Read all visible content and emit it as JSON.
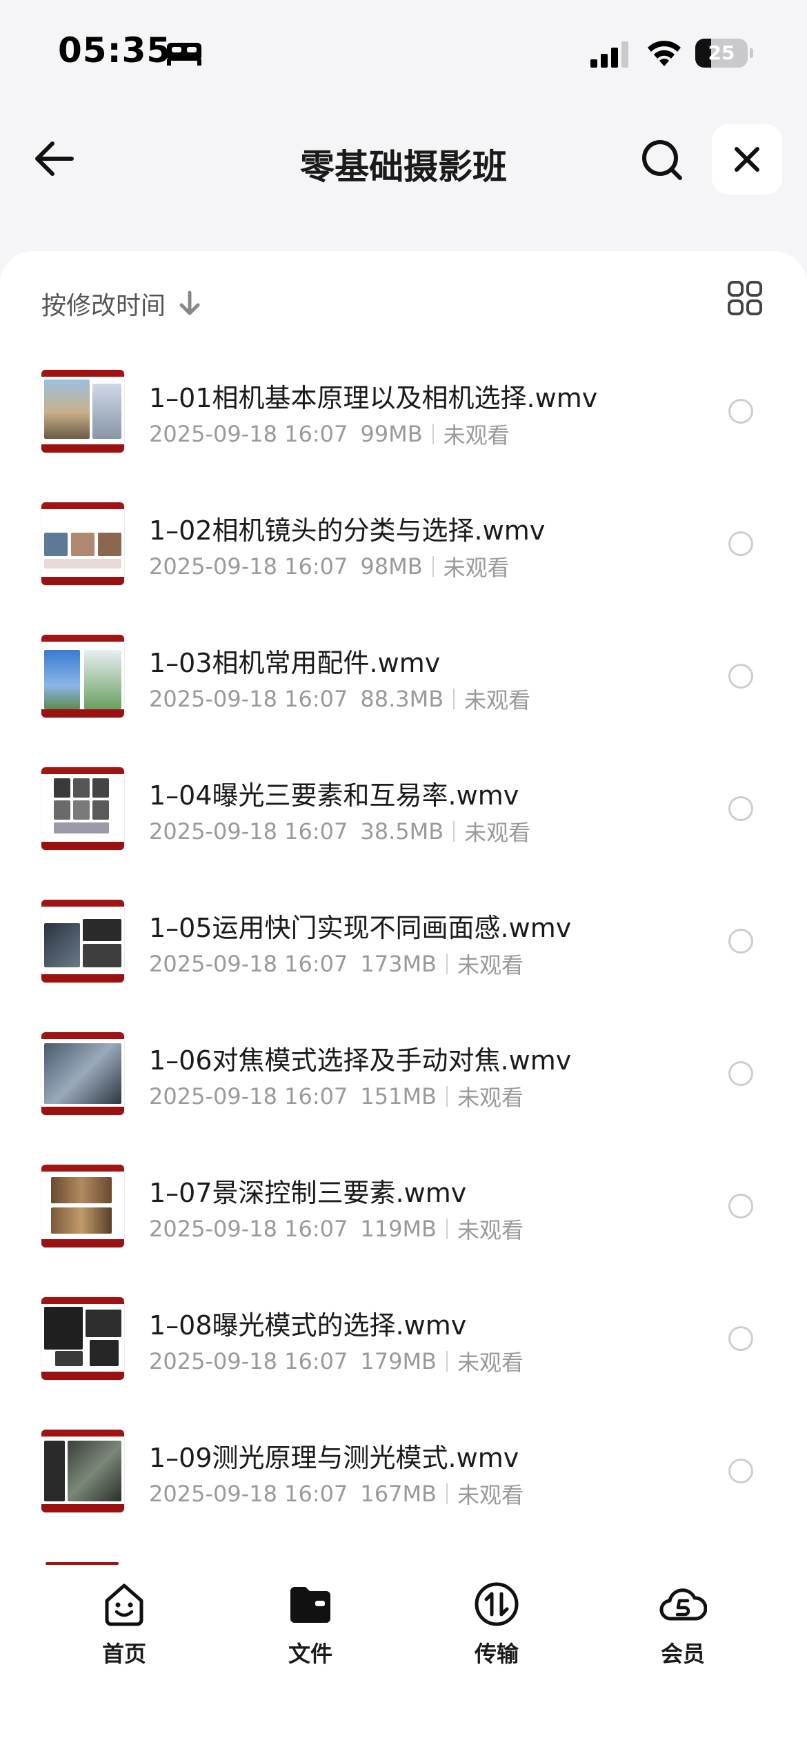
{
  "status_bar": {
    "time": "05:35",
    "battery_level": "25",
    "battery_fraction": 0.3
  },
  "header": {
    "title": "零基础摄影班"
  },
  "sort": {
    "label": "按修改时间"
  },
  "files": [
    {
      "name": "1–01相机基本原理以及相机选择.wmv",
      "date": "2025-09-18 16:07",
      "size": "99MB",
      "status": "未观看"
    },
    {
      "name": "1–02相机镜头的分类与选择.wmv",
      "date": "2025-09-18 16:07",
      "size": "98MB",
      "status": "未观看"
    },
    {
      "name": "1–03相机常用配件.wmv",
      "date": "2025-09-18 16:07",
      "size": "88.3MB",
      "status": "未观看"
    },
    {
      "name": "1–04曝光三要素和互易率.wmv",
      "date": "2025-09-18 16:07",
      "size": "38.5MB",
      "status": "未观看"
    },
    {
      "name": "1–05运用快门实现不同画面感.wmv",
      "date": "2025-09-18 16:07",
      "size": "173MB",
      "status": "未观看"
    },
    {
      "name": "1–06对焦模式选择及手动对焦.wmv",
      "date": "2025-09-18 16:07",
      "size": "151MB",
      "status": "未观看"
    },
    {
      "name": "1–07景深控制三要素.wmv",
      "date": "2025-09-18 16:07",
      "size": "119MB",
      "status": "未观看"
    },
    {
      "name": "1–08曝光模式的选择.wmv",
      "date": "2025-09-18 16:07",
      "size": "179MB",
      "status": "未观看"
    },
    {
      "name": "1–09测光原理与测光模式.wmv",
      "date": "2025-09-18 16:07",
      "size": "167MB",
      "status": "未观看"
    }
  ],
  "tabs": [
    {
      "label": "首页",
      "icon": "smile-face-icon"
    },
    {
      "label": "文件",
      "icon": "folder-icon"
    },
    {
      "label": "传输",
      "icon": "transfer-icon"
    },
    {
      "label": "会员",
      "icon": "vip-cloud-icon"
    }
  ],
  "icons": {
    "back": "arrow-left-icon",
    "search": "search-icon",
    "close": "close-icon",
    "grid": "grid-view-icon",
    "sort": "arrow-down-icon",
    "bed": "bed-icon",
    "signal": "signal-icon",
    "wifi": "wifi-icon"
  },
  "colors": {
    "accent_red": "#a01414",
    "text_primary": "#1a1a1a",
    "text_secondary": "#9a9a9a"
  }
}
